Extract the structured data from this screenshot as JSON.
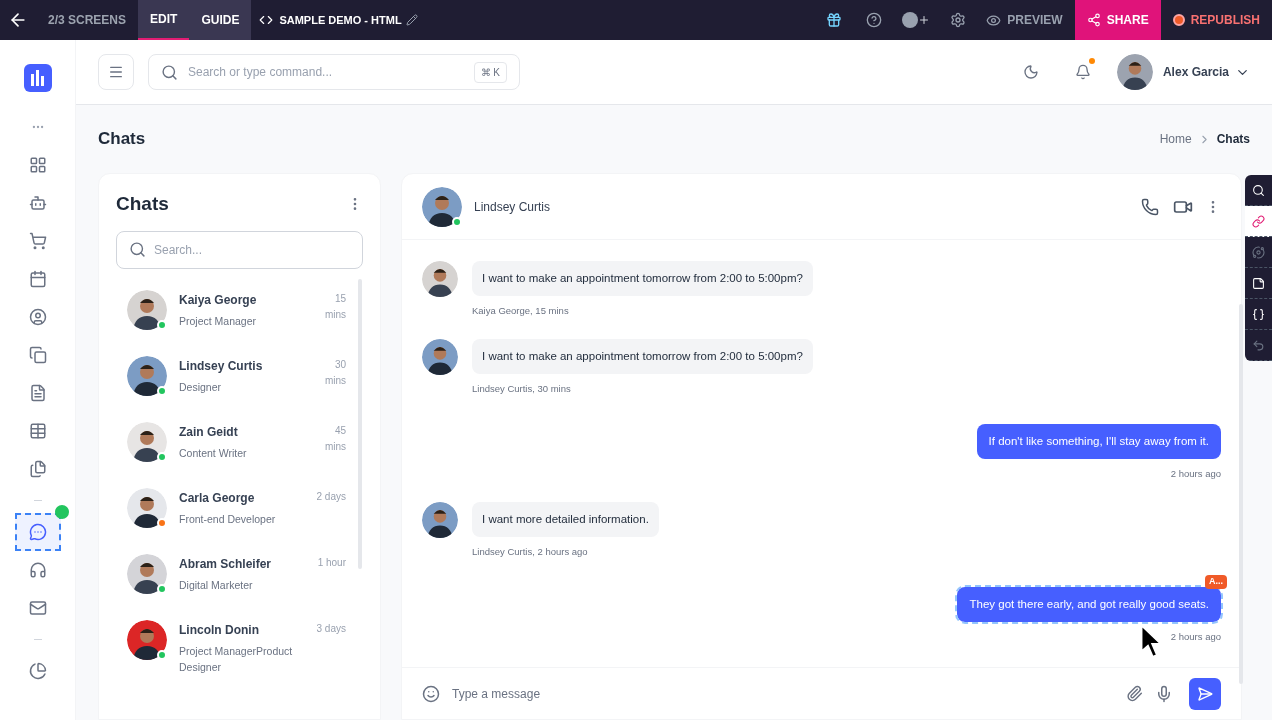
{
  "editor_bar": {
    "screens": "2/3 SCREENS",
    "tabs": [
      {
        "label": "EDIT",
        "selected": true
      },
      {
        "label": "GUIDE",
        "selected": false
      }
    ],
    "project": "SAMPLE DEMO - HTML",
    "preview": "PREVIEW",
    "share": "SHARE",
    "republish": "REPUBLISH"
  },
  "sidebar": {
    "items": [
      {
        "kind": "grid",
        "selected": false
      },
      {
        "kind": "bot",
        "selected": false
      },
      {
        "kind": "cart",
        "selected": false
      },
      {
        "kind": "calendar",
        "selected": false
      },
      {
        "kind": "user",
        "selected": false
      },
      {
        "kind": "copy",
        "selected": false
      },
      {
        "kind": "list",
        "selected": false
      },
      {
        "kind": "table",
        "selected": false
      },
      {
        "kind": "files",
        "selected": false
      },
      {
        "kind": "chat",
        "selected": true
      },
      {
        "kind": "headset",
        "selected": false
      },
      {
        "kind": "mail",
        "selected": false
      },
      {
        "kind": "pie",
        "selected": false
      }
    ]
  },
  "header": {
    "search_placeholder": "Search or type command...",
    "shortcut": "⌘ K",
    "user": "Alex Garcia"
  },
  "page": {
    "title": "Chats",
    "breadcrumb": [
      "Home",
      "Chats"
    ]
  },
  "contacts": {
    "title": "Chats",
    "search_placeholder": "Search...",
    "items": [
      {
        "name": "Kaiya George",
        "role": "Project Manager",
        "time": "15 mins",
        "color": "#22c55e"
      },
      {
        "name": "Lindsey Curtis",
        "role": "Designer",
        "time": "30 mins",
        "color": "#22c55e"
      },
      {
        "name": "Zain Geidt",
        "role": "Content Writer",
        "time": "45 mins",
        "color": "#22c55e"
      },
      {
        "name": "Carla George",
        "role": "Front-end Developer",
        "time": "2 days",
        "color": "#f97316"
      },
      {
        "name": "Abram Schleifer",
        "role": "Digital Marketer",
        "time": "1 hour",
        "color": "#22c55e"
      },
      {
        "name": "Lincoln Donin",
        "role": "Project ManagerProduct Designer",
        "time": "3 days",
        "color": "#22c55e"
      }
    ]
  },
  "chat": {
    "contact": "Lindsey Curtis",
    "messages": [
      {
        "kind": "in",
        "text": "I want to make an appointment tomorrow from 2:00 to 5:00pm?",
        "meta": "Kaiya George, 15 mins",
        "selected": false
      },
      {
        "kind": "in",
        "text": "I want to make an appointment tomorrow from 2:00 to 5:00pm?",
        "meta": "Lindsey Curtis, 30 mins",
        "selected": false
      },
      {
        "kind": "out",
        "text": "If don't like something, I'll stay away from it.",
        "meta": "2 hours ago",
        "selected": false
      },
      {
        "kind": "in",
        "text": "I want more detailed information.",
        "meta": "Lindsey Curtis, 2 hours ago",
        "selected": false
      },
      {
        "kind": "out",
        "text": "They got there early, and got really good seats.",
        "meta": "2 hours ago",
        "selected": true,
        "badge": "A..."
      }
    ],
    "input_placeholder": "Type a message"
  }
}
